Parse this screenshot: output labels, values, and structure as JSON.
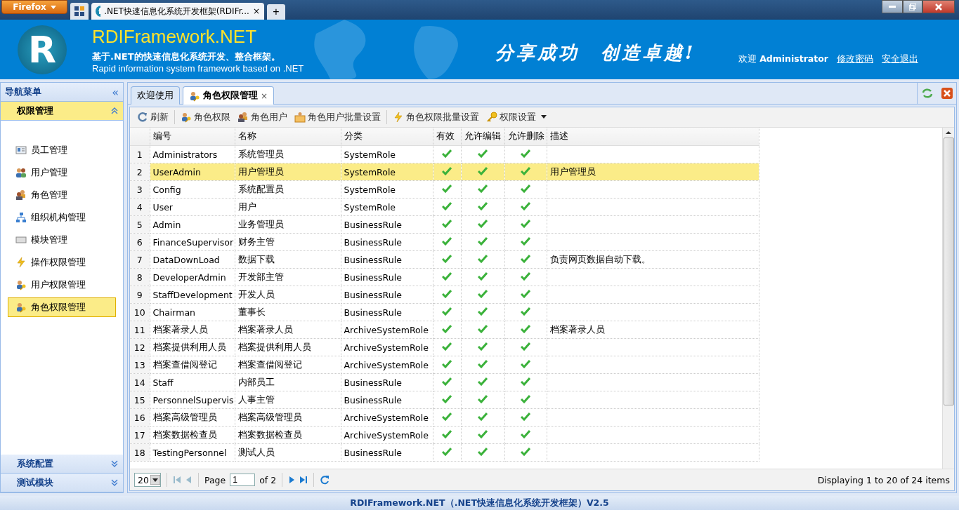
{
  "browser": {
    "menu_button": "Firefox",
    "tabs": [
      {
        "title": ".NET快速信息化系统开发框架(RDIFr...",
        "close": "×",
        "selected": true
      }
    ],
    "new_tab": "+"
  },
  "header": {
    "logo_letter": "R",
    "title": "RDIFramework.NET",
    "subtitle": "基于.NET的快速信息化系统开发、整合框架。",
    "subtitle_en": "Rapid information system framework based on .NET",
    "slogan": "分享成功　创造卓越!",
    "welcome": "欢迎",
    "user": "Administrator",
    "links": [
      "修改密码",
      "安全退出"
    ]
  },
  "sidebar": {
    "title": "导航菜单",
    "collapse": "«",
    "sections": [
      {
        "label": "权限管理",
        "expanded": true,
        "items": [
          {
            "label": "员工管理",
            "kind": "card",
            "selected": false
          },
          {
            "label": "用户管理",
            "kind": "users",
            "selected": false
          },
          {
            "label": "角色管理",
            "kind": "role",
            "selected": false
          },
          {
            "label": "组织机构管理",
            "kind": "org",
            "selected": false
          },
          {
            "label": "模块管理",
            "kind": "module",
            "selected": false
          },
          {
            "label": "操作权限管理",
            "kind": "bolt",
            "selected": false
          },
          {
            "label": "用户权限管理",
            "kind": "userkey",
            "selected": false
          },
          {
            "label": "角色权限管理",
            "kind": "userkey",
            "selected": true
          }
        ]
      },
      {
        "label": "系统配置",
        "expanded": false
      },
      {
        "label": "测试模块",
        "expanded": false
      }
    ]
  },
  "tabs": [
    {
      "label": "欢迎使用",
      "selected": false,
      "closable": false
    },
    {
      "label": "角色权限管理",
      "selected": true,
      "closable": true,
      "close": "×"
    }
  ],
  "toolbar": [
    {
      "label": "刷新",
      "kind": "refresh",
      "separator_after": true
    },
    {
      "label": "角色权限",
      "kind": "userkey",
      "separator_after": false
    },
    {
      "label": "角色用户",
      "kind": "role",
      "separator_after": false
    },
    {
      "label": "角色用户批量设置",
      "kind": "folder",
      "separator_after": true
    },
    {
      "label": "角色权限批量设置",
      "kind": "bolt",
      "separator_after": false
    },
    {
      "label": "权限设置",
      "kind": "key",
      "separator_after": false,
      "dropdown": true
    }
  ],
  "table": {
    "columns": [
      "编号",
      "名称",
      "分类",
      "有效",
      "允许编辑",
      "允许删除",
      "描述"
    ],
    "rows": [
      {
        "n": "1",
        "code": "Administrators",
        "name": "系统管理员",
        "category": "SystemRole",
        "valid": true,
        "editable": true,
        "deletable": true,
        "selected": false
      },
      {
        "n": "2",
        "code": "UserAdmin",
        "name": "用户管理员",
        "category": "SystemRole",
        "valid": true,
        "editable": true,
        "deletable": true,
        "description": "用户管理员",
        "selected": true
      },
      {
        "n": "3",
        "code": "Config",
        "name": "系统配置员",
        "category": "SystemRole",
        "valid": true,
        "editable": true,
        "deletable": true,
        "selected": false
      },
      {
        "n": "4",
        "code": "User",
        "name": "用户",
        "category": "SystemRole",
        "valid": true,
        "editable": true,
        "deletable": true,
        "selected": false
      },
      {
        "n": "5",
        "code": "Admin",
        "name": "业务管理员",
        "category": "BusinessRule",
        "valid": true,
        "editable": true,
        "deletable": true,
        "selected": false
      },
      {
        "n": "6",
        "code": "FinanceSupervisor",
        "name": "财务主管",
        "category": "BusinessRule",
        "valid": true,
        "editable": true,
        "deletable": true,
        "selected": false
      },
      {
        "n": "7",
        "code": "DataDownLoad",
        "name": "数据下载",
        "category": "BusinessRule",
        "valid": true,
        "editable": true,
        "deletable": true,
        "description": "负责网页数据自动下载。",
        "selected": false
      },
      {
        "n": "8",
        "code": "DeveloperAdmin",
        "name": "开发部主管",
        "category": "BusinessRule",
        "valid": true,
        "editable": true,
        "deletable": true,
        "selected": false
      },
      {
        "n": "9",
        "code": "StaffDevelopment",
        "name": "开发人员",
        "category": "BusinessRule",
        "valid": true,
        "editable": true,
        "deletable": true,
        "selected": false
      },
      {
        "n": "10",
        "code": "Chairman",
        "name": "董事长",
        "category": "BusinessRule",
        "valid": true,
        "editable": true,
        "deletable": true,
        "selected": false
      },
      {
        "n": "11",
        "code": "档案著录人员",
        "name": "档案著录人员",
        "category": "ArchiveSystemRole",
        "valid": true,
        "editable": true,
        "deletable": true,
        "description": "档案著录人员",
        "selected": false
      },
      {
        "n": "12",
        "code": "档案提供利用人员",
        "name": "档案提供利用人员",
        "category": "ArchiveSystemRole",
        "valid": true,
        "editable": true,
        "deletable": true,
        "selected": false
      },
      {
        "n": "13",
        "code": "档案查借阅登记",
        "name": "档案查借阅登记",
        "category": "ArchiveSystemRole",
        "valid": true,
        "editable": true,
        "deletable": true,
        "selected": false
      },
      {
        "n": "14",
        "code": "Staff",
        "name": "内部员工",
        "category": "BusinessRule",
        "valid": true,
        "editable": true,
        "deletable": true,
        "selected": false
      },
      {
        "n": "15",
        "code": "PersonnelSupervis",
        "name": "人事主管",
        "category": "BusinessRule",
        "valid": true,
        "editable": true,
        "deletable": true,
        "selected": false
      },
      {
        "n": "16",
        "code": "档案高级管理员",
        "name": "档案高级管理员",
        "category": "ArchiveSystemRole",
        "valid": true,
        "editable": true,
        "deletable": true,
        "selected": false
      },
      {
        "n": "17",
        "code": "档案数据检查员",
        "name": "档案数据检查员",
        "category": "ArchiveSystemRole",
        "valid": true,
        "editable": true,
        "deletable": true,
        "selected": false
      },
      {
        "n": "18",
        "code": "TestingPersonnel",
        "name": "测试人员",
        "category": "BusinessRule",
        "valid": true,
        "editable": true,
        "deletable": true,
        "selected": false
      }
    ]
  },
  "pager": {
    "page_size": "20",
    "page_label": "Page",
    "page": "1",
    "of": "of 2",
    "summary": "Displaying 1 to 20 of 24 items"
  },
  "footer": "RDIFramework.NET（.NET快速信息化系统开发框架）V2.5"
}
